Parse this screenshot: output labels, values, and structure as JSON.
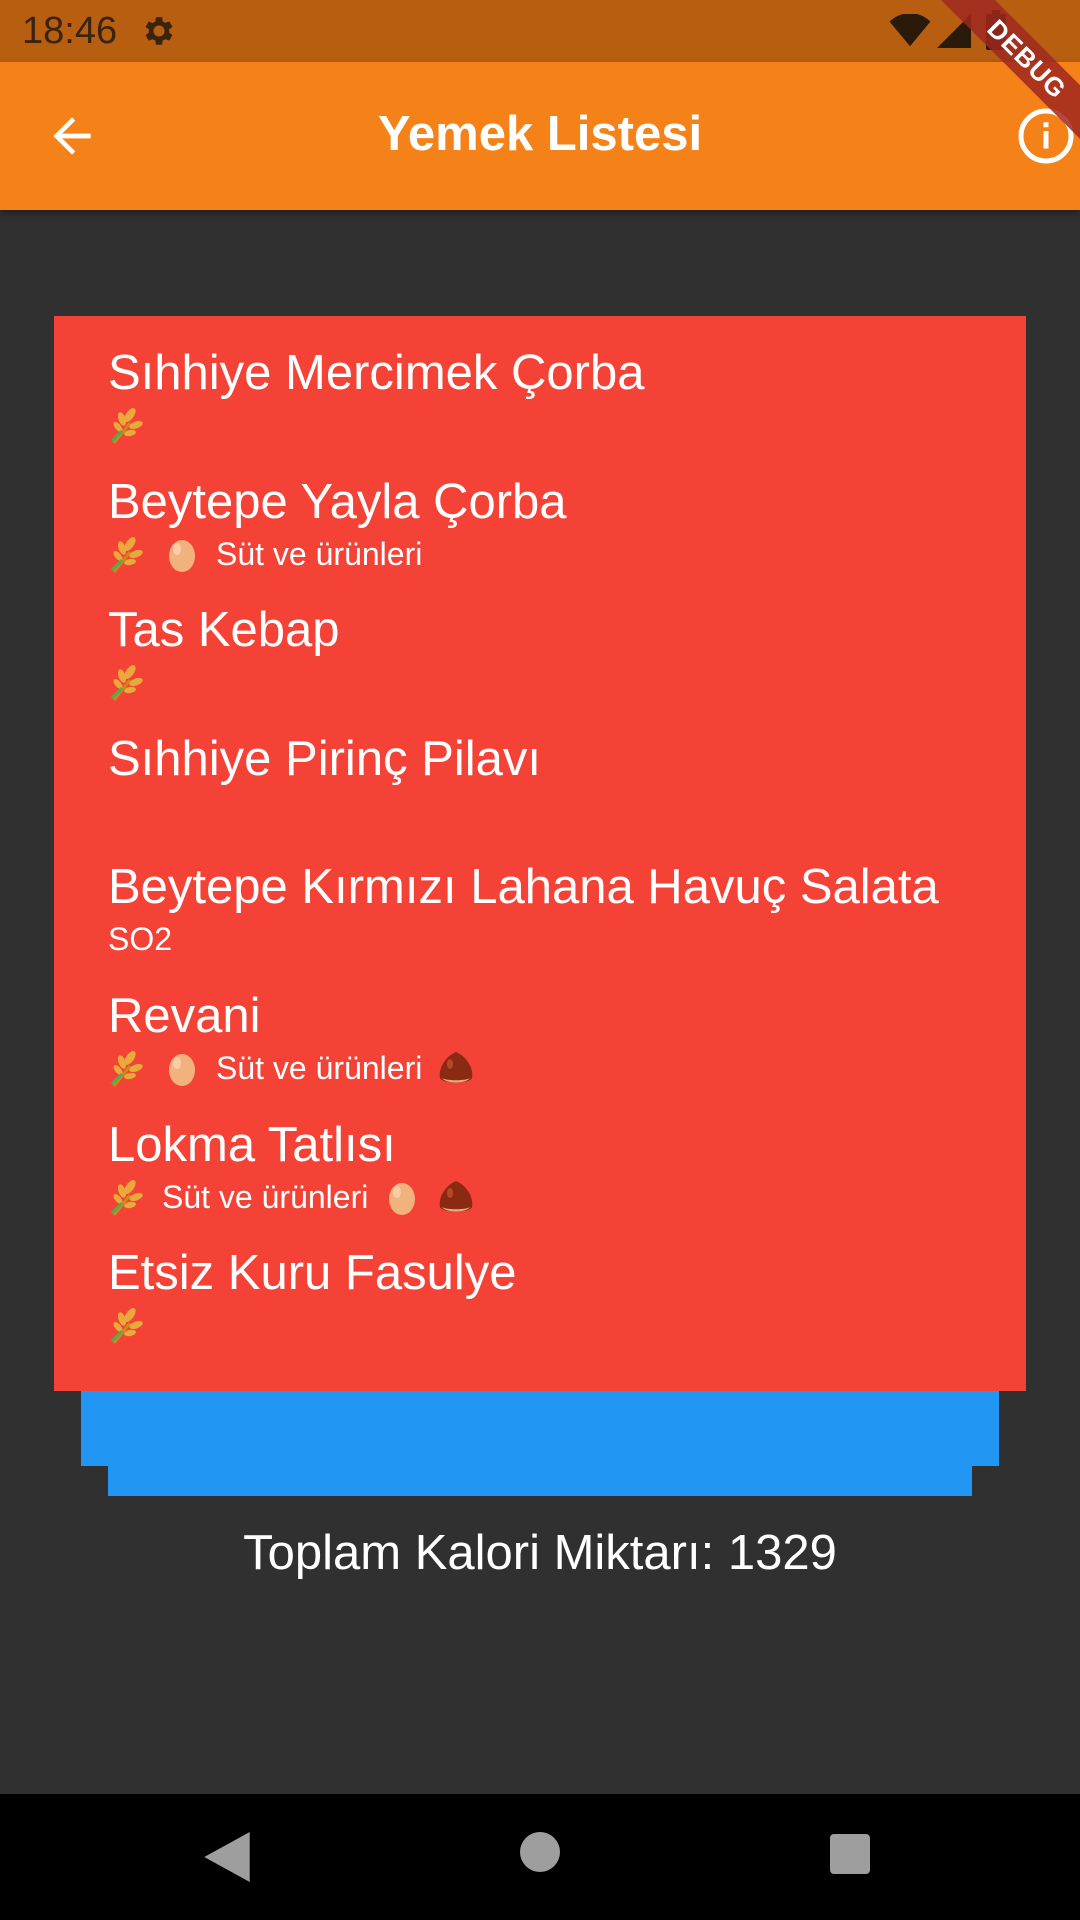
{
  "status_bar": {
    "time": "18:46"
  },
  "app_bar": {
    "title": "Yemek Listesi"
  },
  "debug_banner": "DEBUG",
  "colors": {
    "status_bar": "#B75E11",
    "app_bar": "#F58218",
    "background": "#303030",
    "menu_card": "#F44336",
    "blue_bar": "#2196F3",
    "nav_bar": "#000000"
  },
  "menu": {
    "items": [
      {
        "name": "Sıhhiye Mercimek Çorba",
        "tags": [
          {
            "type": "icon",
            "icon": "wheat-icon"
          }
        ]
      },
      {
        "name": "Beytepe Yayla Çorba",
        "tags": [
          {
            "type": "icon",
            "icon": "wheat-icon"
          },
          {
            "type": "icon",
            "icon": "egg-icon"
          },
          {
            "type": "text",
            "text": "Süt ve ürünleri"
          }
        ]
      },
      {
        "name": "Tas Kebap",
        "tags": [
          {
            "type": "icon",
            "icon": "wheat-icon"
          }
        ]
      },
      {
        "name": "Sıhhiye Pirinç Pilavı",
        "tags": []
      },
      {
        "name": "Beytepe Kırmızı Lahana Havuç Salata",
        "tags": [
          {
            "type": "text",
            "text": "SO2"
          }
        ]
      },
      {
        "name": "Revani",
        "tags": [
          {
            "type": "icon",
            "icon": "wheat-icon"
          },
          {
            "type": "icon",
            "icon": "egg-icon"
          },
          {
            "type": "text",
            "text": "Süt ve ürünleri"
          },
          {
            "type": "icon",
            "icon": "chestnut-icon"
          }
        ]
      },
      {
        "name": "Lokma Tatlısı",
        "tags": [
          {
            "type": "icon",
            "icon": "wheat-icon"
          },
          {
            "type": "text",
            "text": "Süt ve ürünleri"
          },
          {
            "type": "icon",
            "icon": "egg-icon"
          },
          {
            "type": "icon",
            "icon": "chestnut-icon"
          }
        ]
      },
      {
        "name": "Etsiz Kuru Fasulye",
        "tags": [
          {
            "type": "icon",
            "icon": "wheat-icon"
          }
        ]
      }
    ]
  },
  "total": {
    "text": "Toplam Kalori Miktarı: 1329"
  }
}
